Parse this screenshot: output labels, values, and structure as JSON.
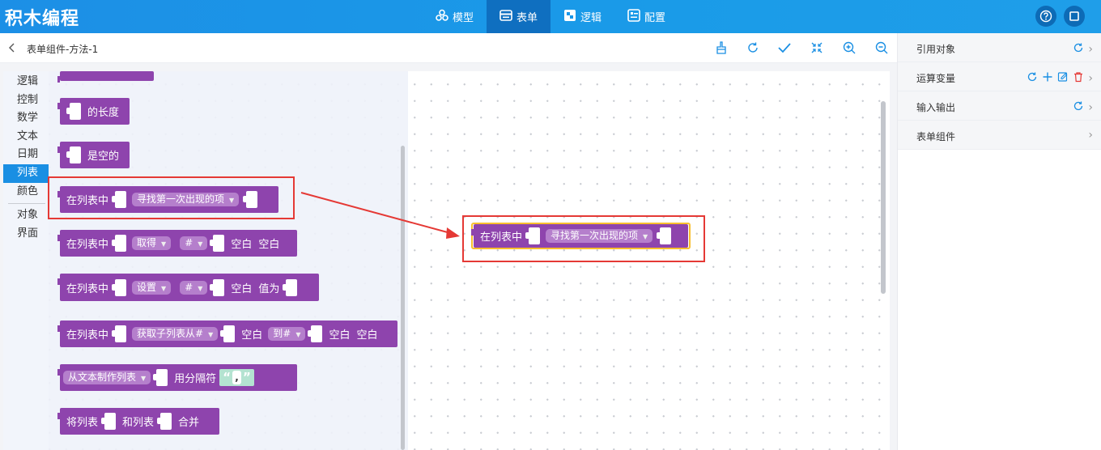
{
  "header": {
    "app_title": "积木编程",
    "nav": [
      {
        "label": "模型",
        "icon": "model-icon",
        "active": false
      },
      {
        "label": "表单",
        "icon": "form-icon",
        "active": true
      },
      {
        "label": "逻辑",
        "icon": "logic-icon",
        "active": false
      },
      {
        "label": "配置",
        "icon": "config-icon",
        "active": false
      }
    ]
  },
  "toolbar": {
    "breadcrumb": "表单组件-方法-1"
  },
  "categories": [
    {
      "label": "逻辑"
    },
    {
      "label": "控制"
    },
    {
      "label": "数学"
    },
    {
      "label": "文本"
    },
    {
      "label": "日期"
    },
    {
      "label": "列表",
      "selected": true
    },
    {
      "label": "颜色"
    },
    {
      "label": "对象"
    },
    {
      "label": "界面"
    }
  ],
  "flyout": {
    "length_of": "的长度",
    "is_empty": "是空的",
    "find_block": {
      "prefix": "在列表中",
      "option": "寻找第一次出现的项"
    },
    "get_block": {
      "prefix": "在列表中",
      "option": "取得",
      "index": "#",
      "text1": "空白",
      "text2": "空白"
    },
    "set_block": {
      "prefix": "在列表中",
      "option": "设置",
      "index": "#",
      "text1": "空白",
      "text2": "值为"
    },
    "sublist_block": {
      "prefix": "在列表中",
      "option1": "获取子列表从#",
      "text1": "空白",
      "option2": "到#",
      "text2": "空白",
      "text3": "空白"
    },
    "split_block": {
      "option": "从文本制作列表",
      "text1": "用分隔符",
      "open_quote": "“",
      "value": ",",
      "close_quote": "”"
    },
    "merge_block": {
      "text1": "将列表",
      "text2": "和列表",
      "text3": "合并"
    }
  },
  "canvas_block": {
    "prefix": "在列表中",
    "option": "寻找第一次出现的项"
  },
  "right_panel": {
    "rows": [
      {
        "label": "引用对象"
      },
      {
        "label": "运算变量"
      },
      {
        "label": "输入输出"
      },
      {
        "label": "表单组件"
      }
    ]
  },
  "colors": {
    "header": "#1a96e8",
    "list_block": "#8e44ad",
    "highlight": "#e53935",
    "selection": "#f8bf2e",
    "delete": "#e53935",
    "accent": "#1a8fe3"
  }
}
